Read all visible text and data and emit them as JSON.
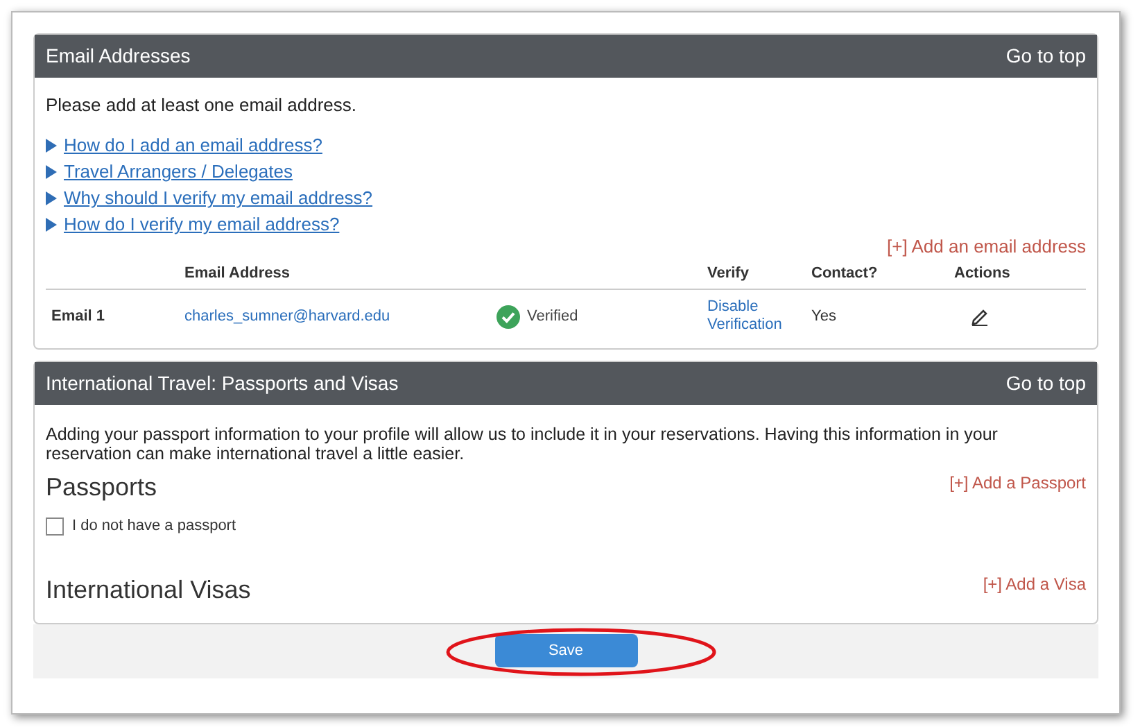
{
  "email_section": {
    "title": "Email Addresses",
    "go_to_top": "Go to top",
    "intro": "Please add at least one email address.",
    "help_links": [
      "How do I add an email address?",
      "Travel Arrangers / Delegates",
      "Why should I verify my email address?",
      "How do I verify my email address?"
    ],
    "add_link": "[+] Add an email address",
    "table": {
      "columns": [
        "Email Address",
        "Verify",
        "Contact?",
        "Actions"
      ],
      "rows": [
        {
          "label": "Email 1",
          "email": "charles_sumner@harvard.edu",
          "verified": true,
          "status": "Verified",
          "verify_action": "Disable Verification",
          "contact": "Yes"
        }
      ]
    }
  },
  "travel_section": {
    "title": "International Travel: Passports and Visas",
    "go_to_top": "Go to top",
    "intro": "Adding your passport information to your profile will allow us to include it in your reservations. Having this information in your reservation can make international travel a little easier.",
    "passports": {
      "heading": "Passports",
      "add_link": "[+] Add a Passport",
      "no_passport": {
        "label": "I do not have a passport",
        "checked": false
      }
    },
    "visas": {
      "heading": "International Visas",
      "add_link": "[+] Add a Visa"
    }
  },
  "save_button": {
    "label": "Save",
    "highlighted": true
  }
}
